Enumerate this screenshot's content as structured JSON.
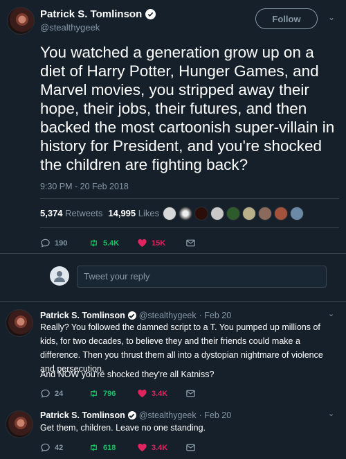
{
  "main_tweet": {
    "author_name": "Patrick S. Tomlinson",
    "handle": "@stealthygeek",
    "follow_label": "Follow",
    "text": "You watched a generation grow up on a diet of Harry Potter, Hunger Games, and Marvel movies, you stripped away their hope, their jobs, their futures, and then backed the most cartoonish super-villain in history for President, and you're shocked the children are fighting back?",
    "timestamp": "9:30 PM - 20 Feb 2018",
    "retweets_count": "5,374",
    "retweets_label": "Retweets",
    "likes_count": "14,995",
    "likes_label": "Likes",
    "actions": {
      "replies": "190",
      "retweets": "5.4K",
      "likes": "15K"
    }
  },
  "reply_box": {
    "placeholder": "Tweet your reply"
  },
  "replies": [
    {
      "author_name": "Patrick S. Tomlinson",
      "handle": "@stealthygeek",
      "date": "· Feb 20",
      "text_1": "Really? You followed the damned script to a T. You pumped up millions of kids, for two decades, to believe they and their friends could make a difference. Then you thrust them all into a dystopian nightmare of violence and persecution.",
      "text_2": "And NOW you're shocked they're all Katniss?",
      "actions": {
        "replies": "24",
        "retweets": "796",
        "likes": "3.4K"
      }
    },
    {
      "author_name": "Patrick S. Tomlinson",
      "handle": "@stealthygeek",
      "date": "· Feb 20",
      "text_1": "Get them, children. Leave no one standing.",
      "actions": {
        "replies": "42",
        "retweets": "618",
        "likes": "3.4K"
      }
    }
  ],
  "colors": {
    "background": "#15202b",
    "secondary_text": "#8899a6",
    "retweet_green": "#17bf63",
    "like_red": "#e0245e",
    "divider": "#38444d"
  }
}
